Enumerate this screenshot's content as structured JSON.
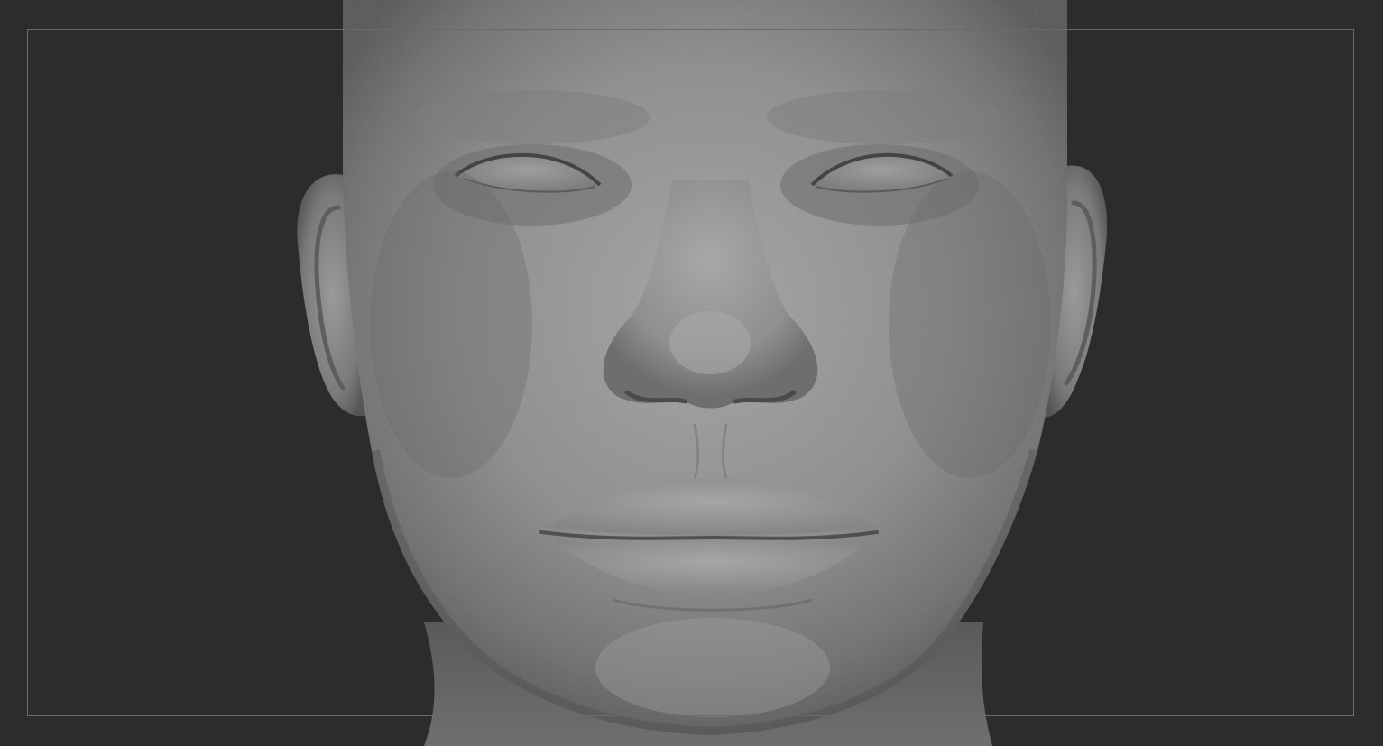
{
  "viewport": {
    "background_color": "#2c2c2c",
    "frame_color": "#6a6a6a",
    "clay_color": "#8e8e8e"
  },
  "model": {
    "subject": "sculpted-head",
    "material": "matcap-clay",
    "view": "front"
  }
}
